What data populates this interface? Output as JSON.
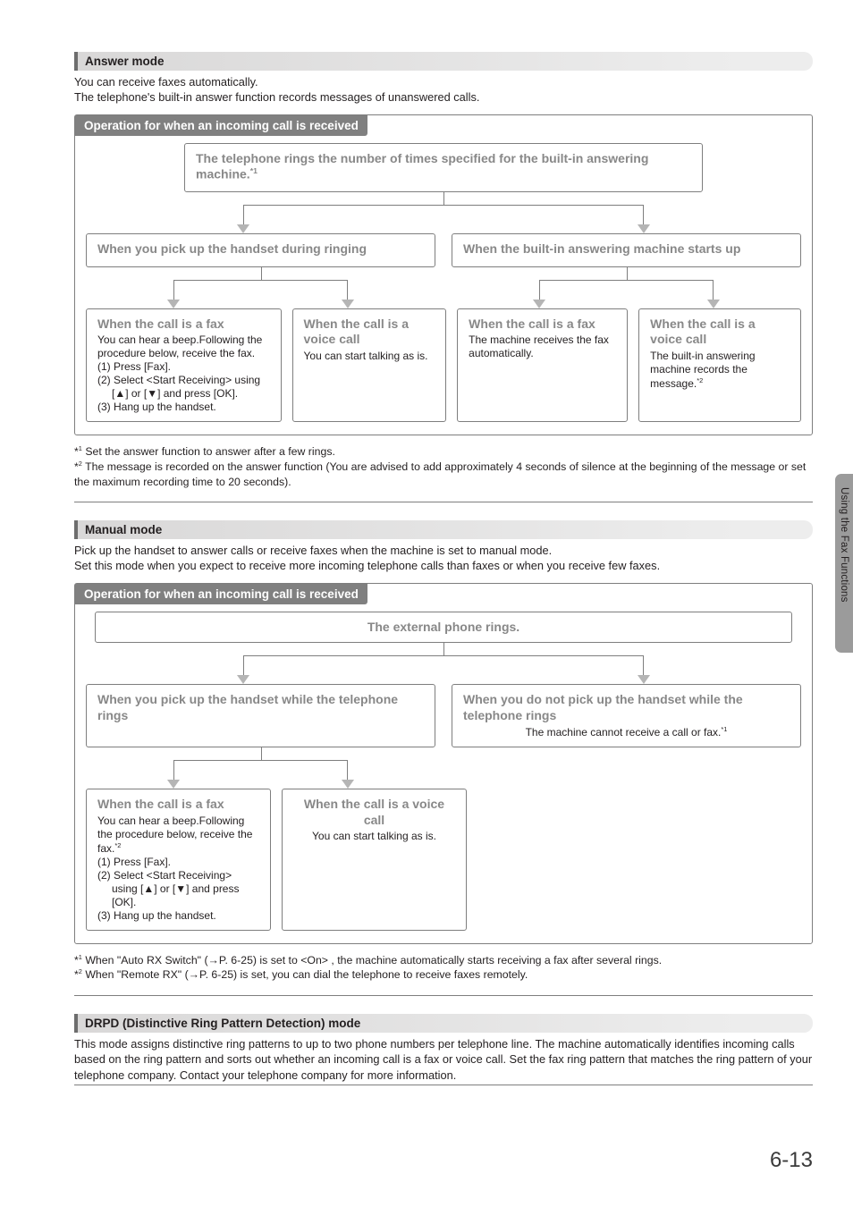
{
  "pageTab": "Using the Fax Functions",
  "pageNumber": "6-13",
  "answer": {
    "title": "Answer mode",
    "intro1": "You can receive faxes automatically.",
    "intro2": "The telephone's built-in answer function records messages of unanswered calls.",
    "flowTab": "Operation for when an incoming call is received",
    "top": "The telephone rings the number of times specified for the built-in answering machine.",
    "topSup": "*1",
    "l2a": "When you pick up the handset during ringing",
    "l2b": "When the built-in answering machine starts up",
    "leaf1_head": "When the call is a fax",
    "leaf1_l1": "You can hear a beep.Following the procedure below, receive the fax.",
    "leaf1_l2": "(1) Press [Fax].",
    "leaf1_l3": "(2) Select <Start Receiving> using [▲] or [▼] and press [OK].",
    "leaf1_l4": "(3) Hang up the handset.",
    "leaf2_head": "When the call is a voice call",
    "leaf2_body": "You can start talking as is.",
    "leaf3_head": "When the call is a fax",
    "leaf3_body": "The machine receives the fax automatically.",
    "leaf4_head": "When the call is a voice call",
    "leaf4_body": "The built-in answering machine records the message.",
    "leaf4_sup": "*2",
    "fn1": " Set the answer function to answer after a few rings.",
    "fn2": " The message is recorded on the answer function (You are advised to add approximately 4 seconds of silence at the beginning of the message or set the maximum recording time to 20 seconds)."
  },
  "manual": {
    "title": "Manual mode",
    "intro1": "Pick up the handset to answer calls or receive faxes when the machine is set to manual mode.",
    "intro2": "Set this mode when you expect to receive more incoming telephone calls than faxes or when you receive few faxes.",
    "flowTab": "Operation for when an incoming call is received",
    "top": "The external phone rings.",
    "l2a": "When you pick up the handset while the telephone rings",
    "l2b_head": "When you do not pick up the handset while the telephone rings",
    "l2b_body": "The machine cannot receive a call or fax.",
    "l2b_sup": "*1",
    "leaf1_head": "When the call is a fax",
    "leaf1_l1": "You can hear a beep.Following the procedure below, receive the fax.",
    "leaf1_sup": "*2",
    "leaf1_l2": "(1) Press [Fax].",
    "leaf1_l3": "(2) Select <Start Receiving> using [▲] or [▼] and press [OK].",
    "leaf1_l4": "(3) Hang up the handset.",
    "leaf2_head": "When the call is a voice call",
    "leaf2_body": "You can start talking as is.",
    "fn1a": " When \"Auto RX Switch\" (",
    "fn1b": "P. 6-25) is set to <On> , the machine automatically starts receiving a fax after several rings.",
    "fn2a": " When \"Remote RX\" (",
    "fn2b": "P. 6-25) is set, you can dial the telephone to receive faxes remotely."
  },
  "drpd": {
    "title": "DRPD (Distinctive Ring Pattern Detection) mode",
    "body": "This mode assigns distinctive ring patterns to up to two phone numbers per telephone line. The machine automatically identifies incoming calls based on the ring pattern and sorts out whether an incoming call is a fax or voice call. Set the fax ring pattern that matches the ring pattern of your telephone company. Contact your telephone company for more information."
  }
}
